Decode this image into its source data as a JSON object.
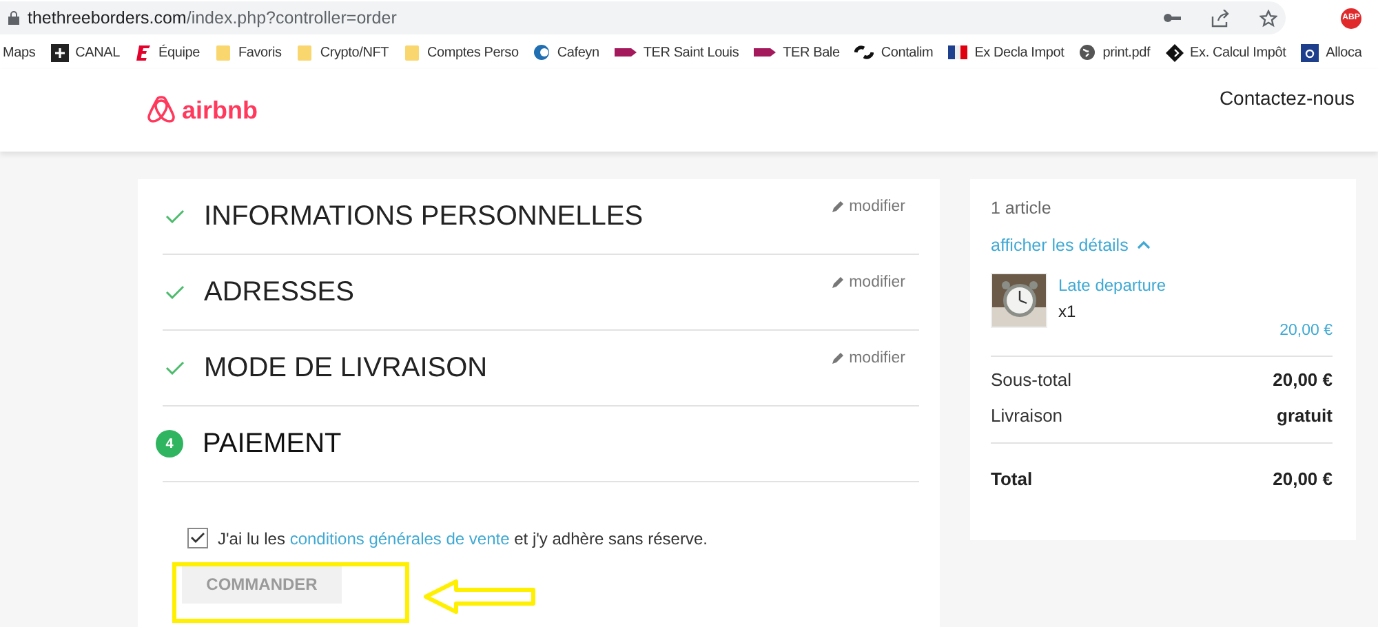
{
  "browser": {
    "url_host": "thethreeborders.com",
    "url_path": "/index.php?controller=order",
    "extension_badge": "ABP",
    "bookmarks": [
      {
        "label": "Maps",
        "kind": "text"
      },
      {
        "label": "CANAL",
        "kind": "plus"
      },
      {
        "label": "Équipe",
        "kind": "e"
      },
      {
        "label": "Favoris",
        "kind": "folder"
      },
      {
        "label": "Crypto/NFT",
        "kind": "folder"
      },
      {
        "label": "Comptes Perso",
        "kind": "folder"
      },
      {
        "label": "Cafeyn",
        "kind": "c"
      },
      {
        "label": "TER Saint Louis",
        "kind": "train"
      },
      {
        "label": "TER Bale",
        "kind": "train"
      },
      {
        "label": "Contalim",
        "kind": "link"
      },
      {
        "label": "Ex Decla Impot",
        "kind": "flag"
      },
      {
        "label": "print.pdf",
        "kind": "globe"
      },
      {
        "label": "Ex. Calcul Impôt",
        "kind": "diamond"
      },
      {
        "label": "Alloca",
        "kind": "a"
      }
    ]
  },
  "header": {
    "logo_text": "airbnb",
    "contact": "Contactez-nous"
  },
  "steps": [
    {
      "title": "INFORMATIONS PERSONNELLES",
      "done": true,
      "edit": "modifier"
    },
    {
      "title": "ADRESSES",
      "done": true,
      "edit": "modifier"
    },
    {
      "title": "MODE DE LIVRAISON",
      "done": true,
      "edit": "modifier"
    },
    {
      "title": "PAIEMENT",
      "done": false,
      "number": "4"
    }
  ],
  "terms": {
    "checked": true,
    "before": "J'ai lu les",
    "link": "conditions générales de vente",
    "after": "et j'y adhère sans réserve."
  },
  "order_button": {
    "label": "COMMANDER",
    "disabled": true
  },
  "summary": {
    "count": "1 article",
    "details_toggle": "afficher les détails",
    "expanded": true,
    "item": {
      "name": "Late departure",
      "quantity": "x1",
      "price": "20,00 €"
    },
    "lines": [
      {
        "label": "Sous-total",
        "value": "20,00 €"
      },
      {
        "label": "Livraison",
        "value": "gratuit"
      }
    ],
    "total": {
      "label": "Total",
      "value": "20,00 €"
    }
  }
}
